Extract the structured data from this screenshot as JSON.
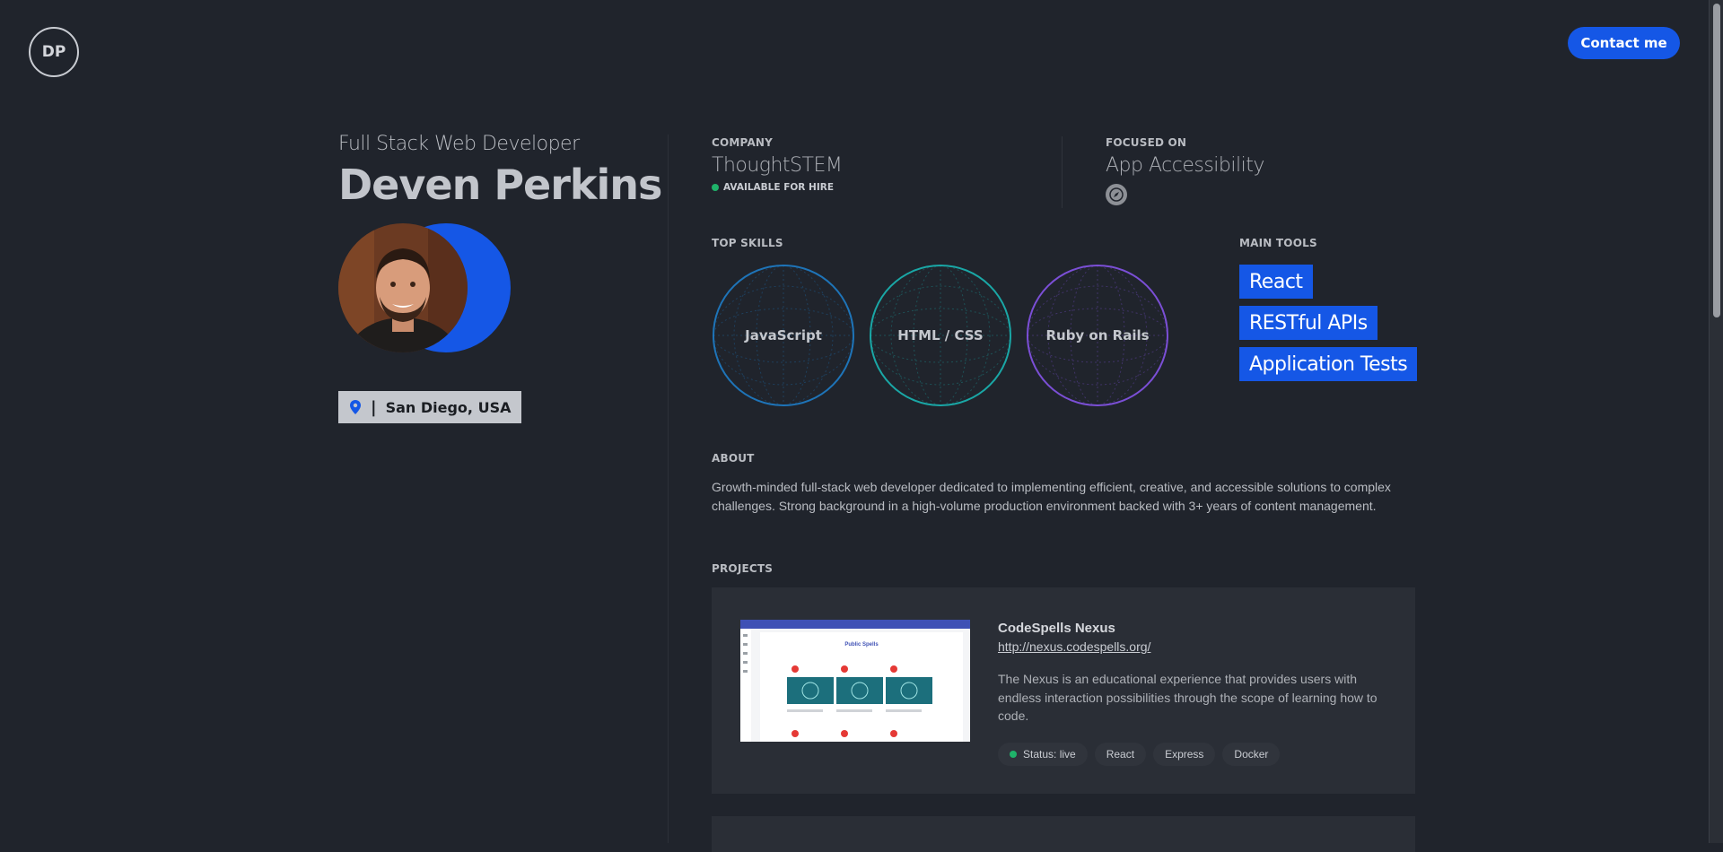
{
  "header": {
    "logo_initials": "DP",
    "contact_label": "Contact me"
  },
  "profile": {
    "role": "Full Stack Web Developer",
    "name": "Deven Perkins",
    "location": "San Diego, USA",
    "location_separator": "|"
  },
  "company": {
    "label": "COMPANY",
    "value": "ThoughtSTEM",
    "status": "AVAILABLE FOR HIRE",
    "status_color": "#1fb36a"
  },
  "focus": {
    "label": "FOCUSED ON",
    "value": "App Accessibility",
    "icon": "compass-icon"
  },
  "skills": {
    "label": "TOP SKILLS",
    "items": [
      {
        "name": "JavaScript",
        "color": "#1e74b8"
      },
      {
        "name": "HTML / CSS",
        "color": "#1aa7a6"
      },
      {
        "name": "Ruby on Rails",
        "color": "#7b4fd6"
      }
    ]
  },
  "tools": {
    "label": "MAIN TOOLS",
    "items": [
      "React",
      "RESTful APIs",
      "Application Tests"
    ]
  },
  "about": {
    "label": "ABOUT",
    "text": "Growth-minded full-stack web developer dedicated to implementing efficient, creative, and accessible solutions to complex challenges. Strong background in a high-volume production environment backed with 3+ years of content management."
  },
  "projects": {
    "label": "PROJECTS",
    "items": [
      {
        "title": "CodeSpells Nexus",
        "url": "http://nexus.codespells.org/",
        "description": "The Nexus is an educational experience that provides users with endless interaction possibilities through the scope of learning how to code.",
        "status": "Status: live",
        "tags": [
          "React",
          "Express",
          "Docker"
        ],
        "thumbnail_title": "Public Spells"
      }
    ]
  },
  "colors": {
    "accent": "#1557e6",
    "background": "#20242c",
    "card": "#2a2e36"
  }
}
